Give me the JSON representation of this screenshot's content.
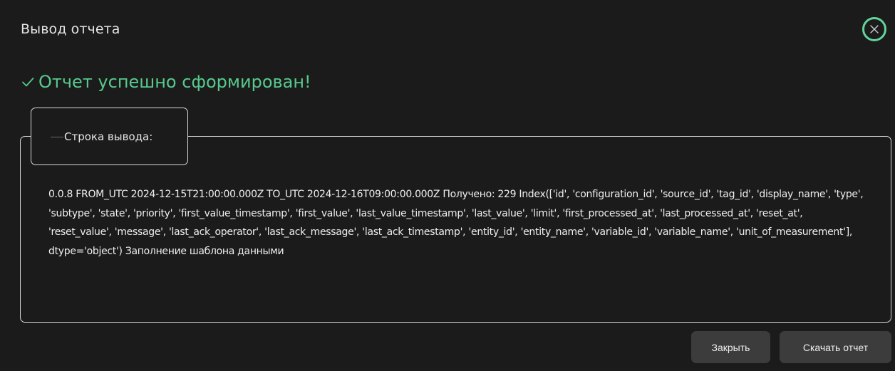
{
  "dialog": {
    "title": "Вывод отчета",
    "close_icon": "close-icon",
    "accent_color": "#58c98c"
  },
  "status": {
    "icon": "checkmark-icon",
    "message": "Отчет успешно сформирован!"
  },
  "output": {
    "legend": "Строка вывода:",
    "text": "0.0.8 FROM_UTC 2024-12-15T21:00:00.000Z TO_UTC 2024-12-16T09:00:00.000Z Получено: 229 Index(['id', 'configuration_id', 'source_id', 'tag_id', 'display_name', 'type', 'subtype', 'state', 'priority', 'first_value_timestamp', 'first_value', 'last_value_timestamp', 'last_value', 'limit', 'first_processed_at', 'last_processed_at', 'reset_at', 'reset_value', 'message', 'last_ack_operator', 'last_ack_message', 'last_ack_timestamp', 'entity_id', 'entity_name', 'variable_id', 'variable_name', 'unit_of_measurement'], dtype='object') Заполнение шаблона данными"
  },
  "actions": {
    "close_label": "Закрыть",
    "download_label": "Скачать отчет"
  }
}
